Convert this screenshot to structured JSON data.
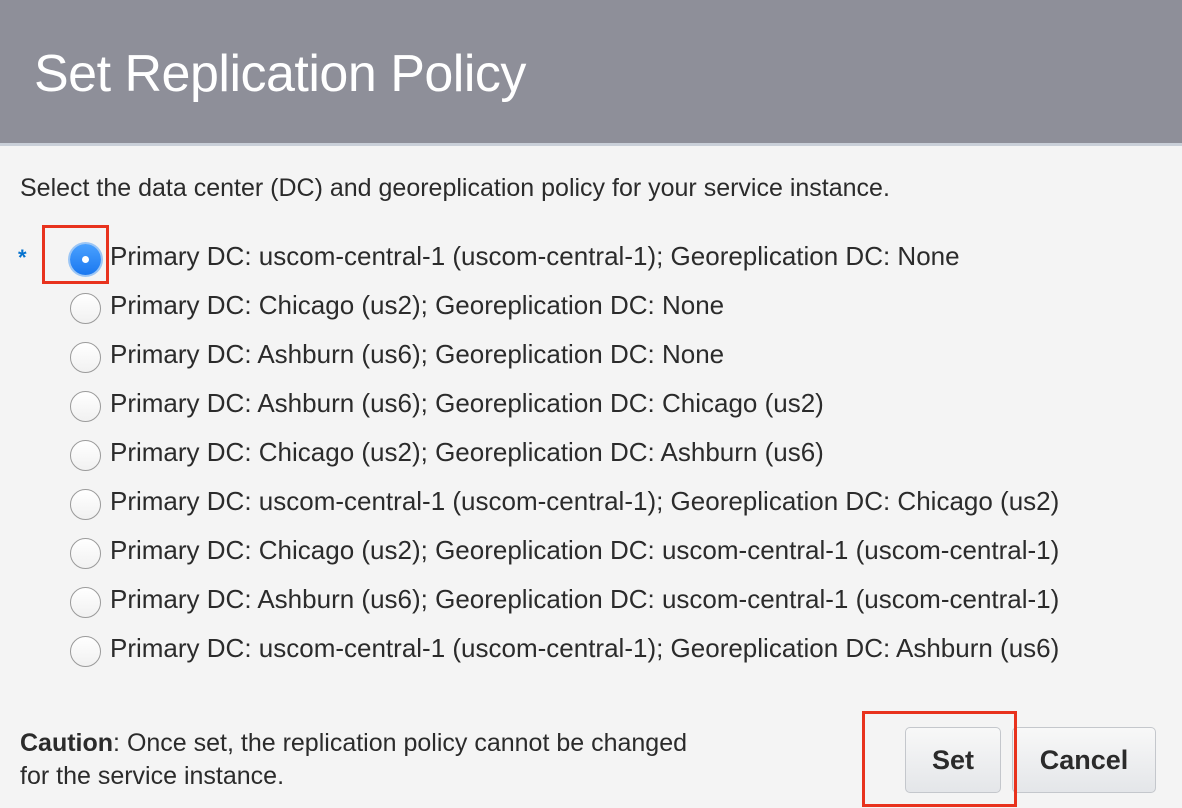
{
  "dialog": {
    "title": "Set Replication Policy",
    "instructions": "Select the data center (DC) and georeplication policy for your service instance.",
    "required_marker": "*",
    "options": [
      {
        "label": "Primary DC: uscom-central-1 (uscom-central-1); Georeplication DC: None",
        "selected": true
      },
      {
        "label": "Primary DC: Chicago (us2); Georeplication DC: None",
        "selected": false
      },
      {
        "label": "Primary DC: Ashburn (us6); Georeplication DC: None",
        "selected": false
      },
      {
        "label": "Primary DC: Ashburn (us6); Georeplication DC: Chicago (us2)",
        "selected": false
      },
      {
        "label": "Primary DC: Chicago (us2); Georeplication DC: Ashburn (us6)",
        "selected": false
      },
      {
        "label": "Primary DC: uscom-central-1 (uscom-central-1); Georeplication DC: Chicago (us2)",
        "selected": false
      },
      {
        "label": "Primary DC: Chicago (us2); Georeplication DC: uscom-central-1 (uscom-central-1)",
        "selected": false
      },
      {
        "label": "Primary DC: Ashburn (us6); Georeplication DC: uscom-central-1 (uscom-central-1)",
        "selected": false
      },
      {
        "label": "Primary DC: uscom-central-1 (uscom-central-1); Georeplication DC: Ashburn (us6)",
        "selected": false
      }
    ],
    "caution": {
      "label": "Caution",
      "text": ": Once set, the replication policy cannot be changed for the service instance."
    },
    "buttons": {
      "set_label": "Set",
      "cancel_label": "Cancel"
    }
  },
  "colors": {
    "header_bg": "#8e8f99",
    "radio_selected": "#1a78f0",
    "highlight_box": "#e8321d",
    "required_marker": "#0572ce"
  }
}
